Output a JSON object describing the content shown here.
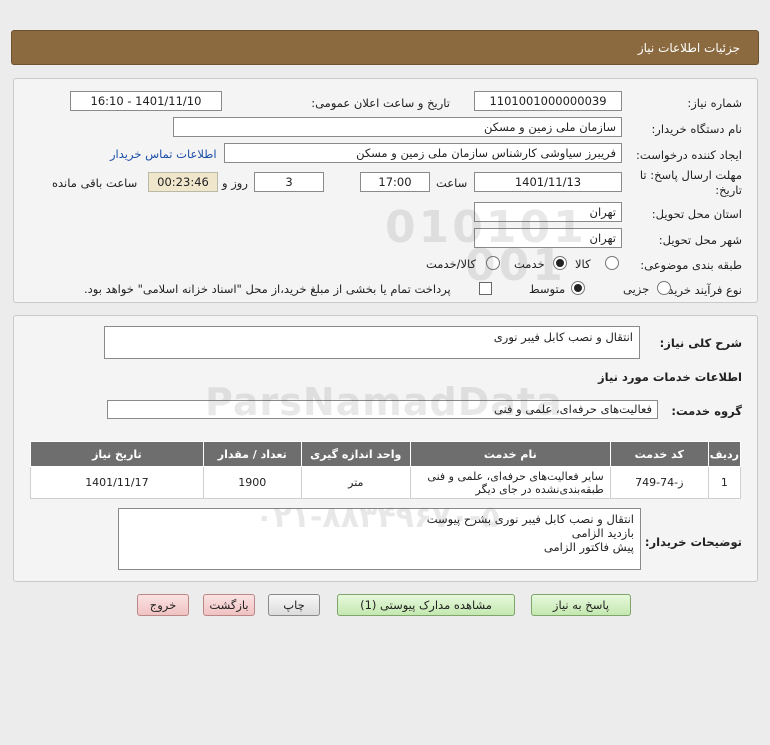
{
  "header": {
    "title": "جزئیات اطلاعات نیاز"
  },
  "form": {
    "need_number_label": "شماره نیاز:",
    "need_number": "1101001000000039",
    "announce_label": "تاریخ و ساعت اعلان عمومی:",
    "announce_value": "1401/11/10 - 16:10",
    "buyer_org_label": "نام دستگاه خریدار:",
    "buyer_org": "سازمان ملی زمین و مسکن",
    "creator_label": "ایجاد کننده درخواست:",
    "creator": "فریبرز سیاوشی کارشناس سازمان ملی زمین و مسکن",
    "contact_link": "اطلاعات تماس خریدار",
    "deadline_label_1": "مهلت ارسال پاسخ: تا",
    "deadline_label_2": "تاریخ:",
    "deadline_date": "1401/11/13",
    "time_label": "ساعت",
    "deadline_time": "17:00",
    "days_value": "3",
    "days_label": "روز و",
    "remaining_time": "00:23:46",
    "remaining_label": "ساعت باقی مانده",
    "province_label": "استان محل تحویل:",
    "province": "تهران",
    "city_label": "شهر محل تحویل:",
    "city": "تهران",
    "category_label": "طبقه بندی موضوعی:",
    "category_options": [
      "کالا",
      "خدمت",
      "کالا/خدمت"
    ],
    "category_selected": "خدمت",
    "purchase_type_label": "نوع فرآیند خرید :",
    "purchase_options": [
      "جزیی",
      "متوسط"
    ],
    "purchase_selected": "متوسط",
    "treasury_note": "پرداخت تمام یا بخشی از مبلغ خرید،از محل \"اسناد خزانه اسلامی\" خواهد بود."
  },
  "details": {
    "summary_label": "شرح کلی نیاز:",
    "summary": "انتقال و نصب کابل فیبر نوری",
    "services_title": "اطلاعات خدمات مورد نیاز",
    "service_group_label": "گروه خدمت:",
    "service_group": "فعالیت‌های حرفه‌ای، علمی و فنی",
    "table": {
      "headers": [
        "ردیف",
        "کد خدمت",
        "نام خدمت",
        "واحد اندازه گیری",
        "تعداد / مقدار",
        "تاریخ نیاز"
      ],
      "rows": [
        [
          "1",
          "ز-74-749",
          "سایر فعالیت‌های حرفه‌ای، علمی و فنی طبقه‌بندی‌نشده در جای دیگر",
          "متر",
          "1900",
          "1401/11/17"
        ]
      ]
    },
    "buyer_notes_label": "توضیحات خریدار:",
    "buyer_notes": [
      "انتقال و نصب کابل فیبر نوری بشرح پیوست",
      "بازدید الزامی",
      "پیش فاکتور الزامی"
    ]
  },
  "buttons": {
    "reply": "پاسخ به نیاز",
    "attachments": "مشاهده مدارک پیوستی (1)",
    "print": "چاپ",
    "back": "بازگشت",
    "exit": "خروج"
  },
  "watermark": {
    "digits_1": "010101",
    "digits_2": "001",
    "brand": "ParsNamadData",
    "phone": "۰۲۱-۸۸۳۴۹۶۷۰-۵"
  },
  "colors": {
    "header_bg": "#8b6a3f",
    "accent_link": "#1c4fa8",
    "table_header": "#6e6e6e"
  }
}
